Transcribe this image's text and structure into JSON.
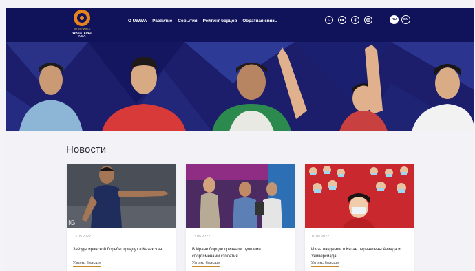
{
  "logo": {
    "small_text": "UNITED WORLD",
    "main_text": "WRESTLING ASIA"
  },
  "nav": {
    "items": [
      "О UWWA",
      "Развитие",
      "События",
      "Рейтинг борцов",
      "Обратная связь"
    ]
  },
  "social": {
    "icons": [
      "whatsapp-icon",
      "youtube-icon",
      "facebook-icon",
      "instagram-icon"
    ]
  },
  "lang": {
    "ru": "RU",
    "en": "EN"
  },
  "news": {
    "title": "Новости",
    "cards": [
      {
        "date": "13.05.2022",
        "headline": "Звёзды иранской борьбы приедут в Казахстан...",
        "more": "Узнать больше"
      },
      {
        "date": "13.05.2022",
        "headline": "В Иране борцов признали лучшими спортсменами столетия...",
        "more": "Узнать больше"
      },
      {
        "date": "10.05.2022",
        "headline": "Из-за пандемии в Китае перенесены Азиада и Универсиада...",
        "more": "Узнать больше"
      }
    ]
  },
  "colors": {
    "header_bg": "#11135a",
    "accent": "#e8821e",
    "page_bg": "#f3f3f7"
  }
}
